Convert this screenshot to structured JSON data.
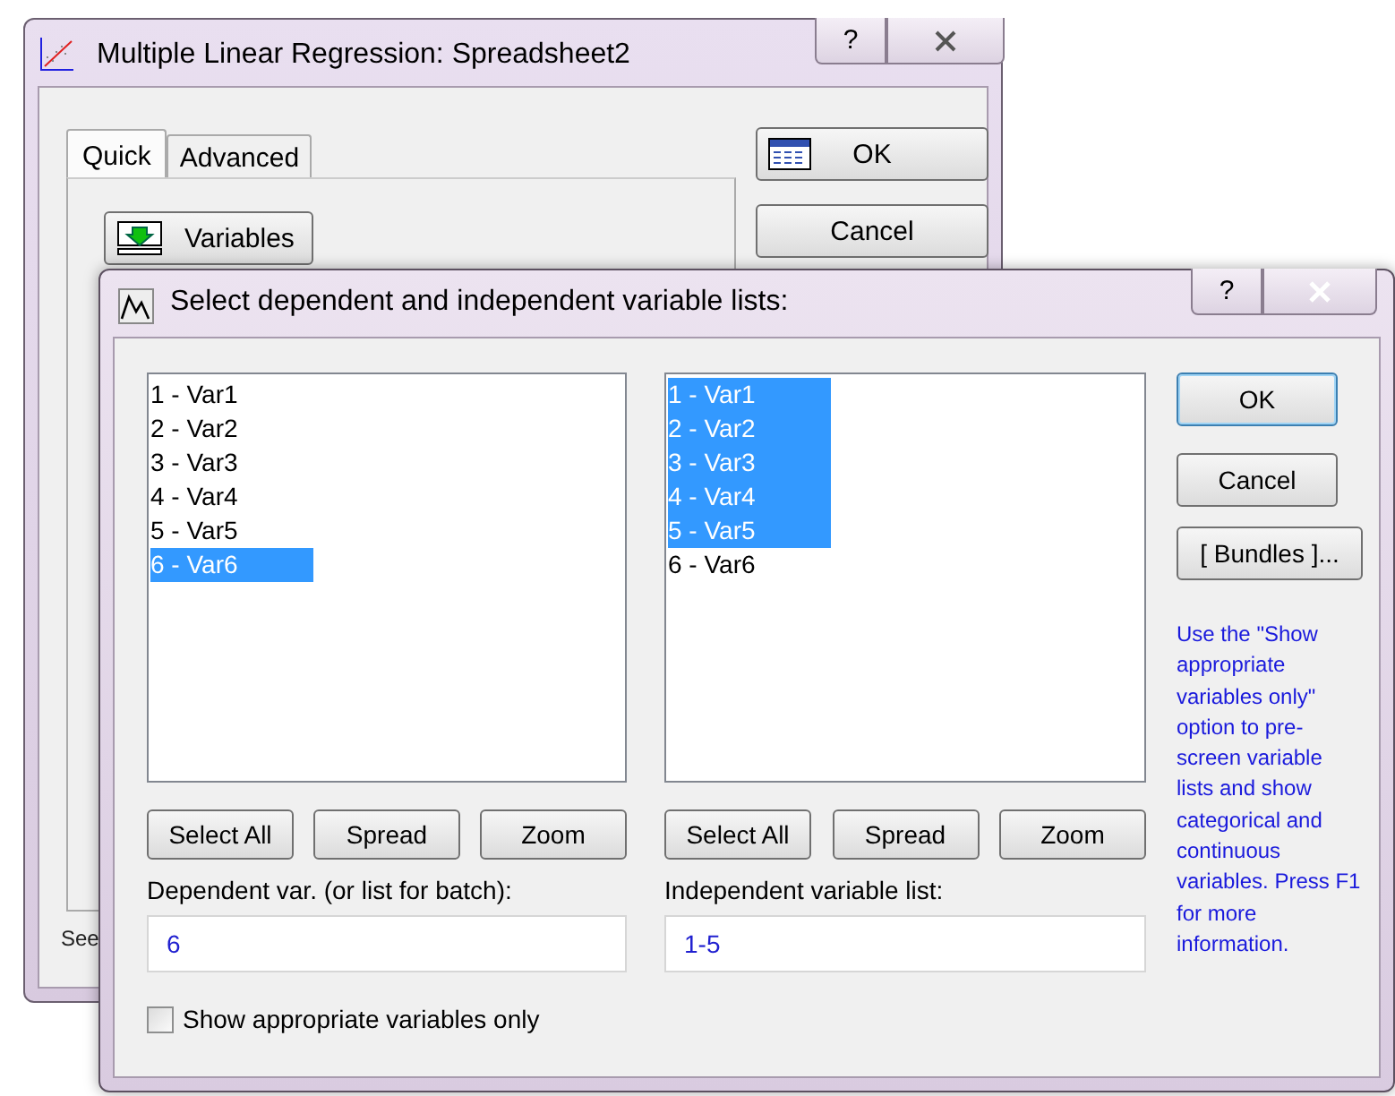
{
  "back_window": {
    "title": "Multiple Linear Regression: Spreadsheet2",
    "help_button": "?",
    "tabs": [
      {
        "label": "Quick",
        "selected": true
      },
      {
        "label": "Advanced",
        "selected": false
      }
    ],
    "variables_button": "Variables",
    "ok_button": "OK",
    "cancel_button": "Cancel",
    "status_text": "See"
  },
  "dialog": {
    "title": "Select dependent and independent variable lists:",
    "help_button": "?",
    "lists": [
      {
        "items": [
          {
            "label": "1 - Var1",
            "selected": false
          },
          {
            "label": "2 - Var2",
            "selected": false
          },
          {
            "label": "3 - Var3",
            "selected": false
          },
          {
            "label": "4 - Var4",
            "selected": false
          },
          {
            "label": "5 - Var5",
            "selected": false
          },
          {
            "label": "6 - Var6",
            "selected": true
          }
        ],
        "buttons": [
          "Select All",
          "Spread",
          "Zoom"
        ],
        "field_label": "Dependent var. (or list for batch):",
        "field_value": "6"
      },
      {
        "items": [
          {
            "label": "1 - Var1",
            "selected": true
          },
          {
            "label": "2 - Var2",
            "selected": true
          },
          {
            "label": "3 - Var3",
            "selected": true
          },
          {
            "label": "4 - Var4",
            "selected": true
          },
          {
            "label": "5 - Var5",
            "selected": true
          },
          {
            "label": "6 - Var6",
            "selected": false
          }
        ],
        "buttons": [
          "Select All",
          "Spread",
          "Zoom"
        ],
        "field_label": "Independent variable list:",
        "field_value": "1-5"
      }
    ],
    "ok_button": "OK",
    "cancel_button": "Cancel",
    "bundles_button": "[ Bundles ]...",
    "help_text": "Use the \"Show appropriate variables only\" option to pre-screen variable lists and show categorical and continuous variables. Press F1 for more information.",
    "checkbox": {
      "label": "Show appropriate variables only",
      "checked": false
    }
  }
}
